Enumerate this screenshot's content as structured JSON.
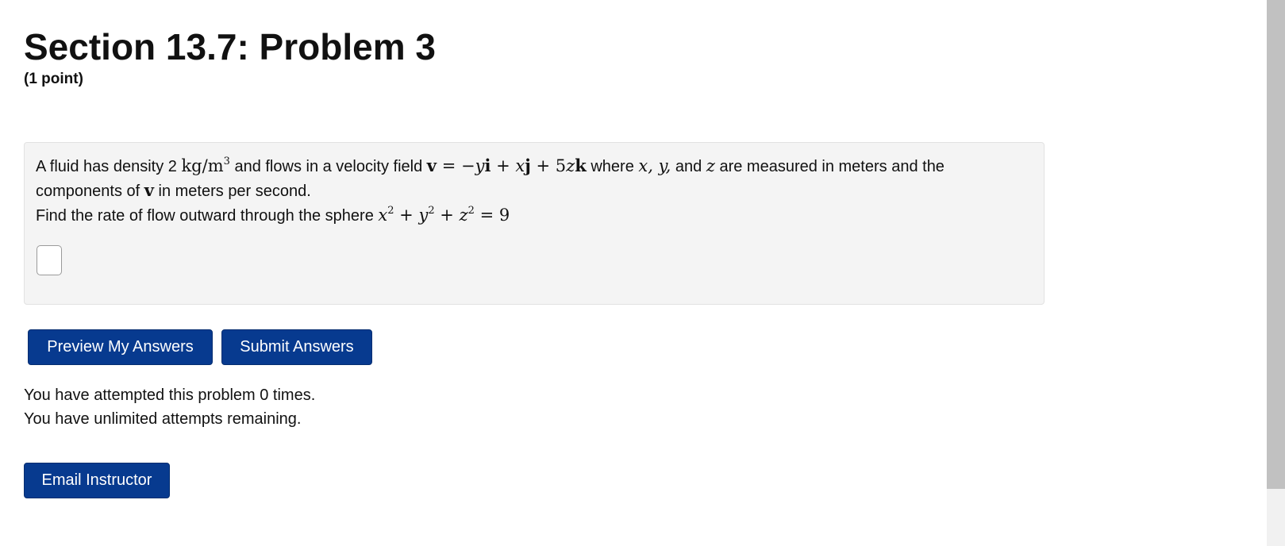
{
  "header": {
    "title": "Section 13.7: Problem 3",
    "points": "(1 point)"
  },
  "problem": {
    "line1_intro": "A fluid has density 2 ",
    "density_units_base": "kg/m",
    "density_units_exp": "3",
    "line1_after_units": " and flows in a velocity field ",
    "field_eq": "= −",
    "line1_where": " where ",
    "vars_xy": "x, y,",
    "and_text": " and ",
    "var_z": "z",
    "line1_end": " are measured in meters and the",
    "line2_start": "components of ",
    "line2_end": " in meters per second.",
    "line3_start": "Find the rate of flow outward through the sphere ",
    "sphere_rhs": "= 9",
    "answer_value": "",
    "answer_placeholder": ""
  },
  "buttons": {
    "preview": "Preview My Answers",
    "submit": "Submit Answers",
    "email": "Email Instructor"
  },
  "status": {
    "attempts_line": "You have attempted this problem 0 times.",
    "remaining_line": "You have unlimited attempts remaining."
  },
  "colors": {
    "button_bg": "#073a8f",
    "panel_bg": "#f4f4f4"
  }
}
